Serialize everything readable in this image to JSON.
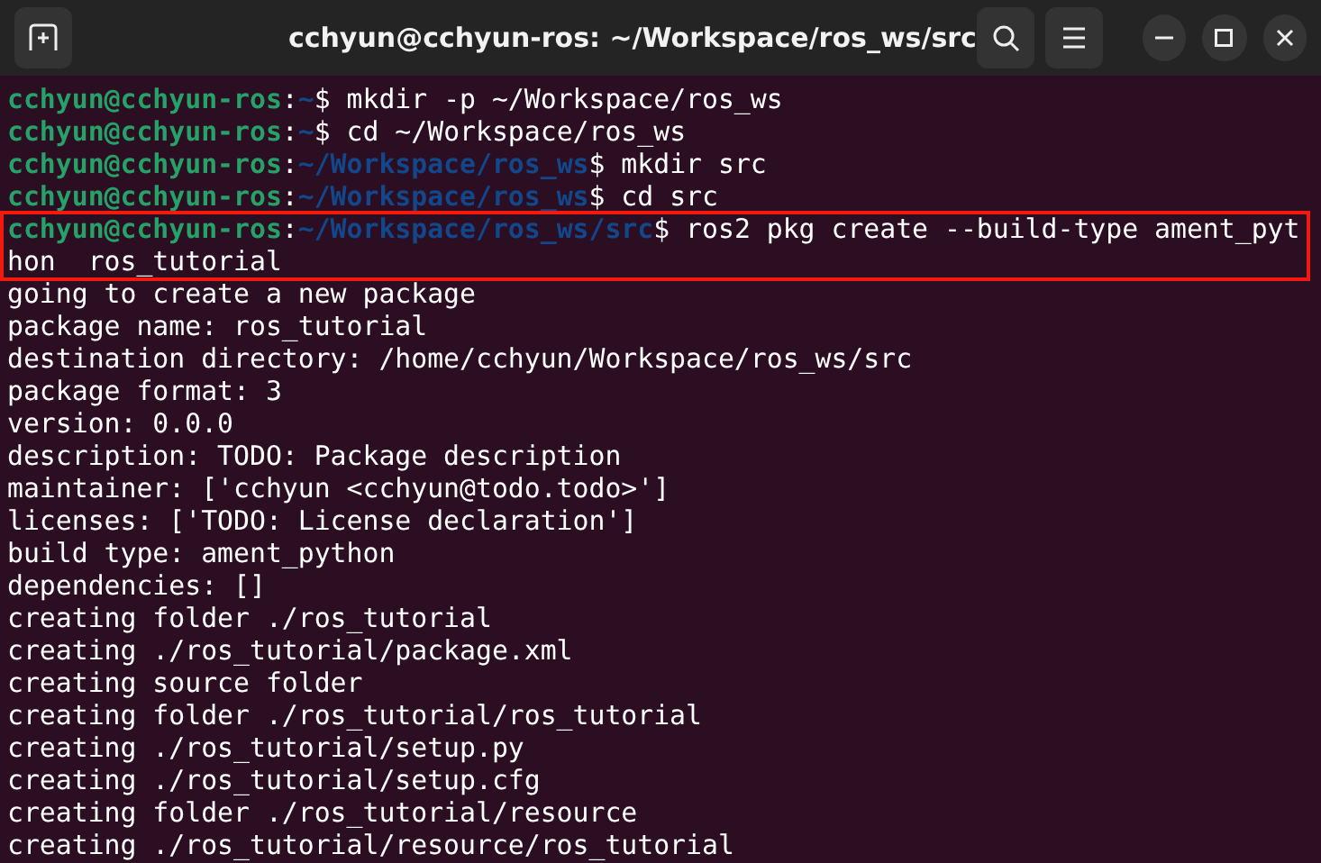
{
  "window": {
    "title": "cchyun@cchyun-ros: ~/Workspace/ros_ws/src"
  },
  "terminal": {
    "lines": [
      {
        "kind": "prompt",
        "user": "cchyun@cchyun-ros",
        "colon": ":",
        "path": "~",
        "dollar": "$",
        "command": " mkdir -p ~/Workspace/ros_ws"
      },
      {
        "kind": "prompt",
        "user": "cchyun@cchyun-ros",
        "colon": ":",
        "path": "~",
        "dollar": "$",
        "command": " cd ~/Workspace/ros_ws"
      },
      {
        "kind": "prompt",
        "user": "cchyun@cchyun-ros",
        "colon": ":",
        "path": "~/Workspace/ros_ws",
        "dollar": "$",
        "command": " mkdir src"
      },
      {
        "kind": "prompt",
        "user": "cchyun@cchyun-ros",
        "colon": ":",
        "path": "~/Workspace/ros_ws",
        "dollar": "$",
        "command": " cd src"
      },
      {
        "kind": "prompt",
        "user": "cchyun@cchyun-ros",
        "colon": ":",
        "path": "~/Workspace/ros_ws/src",
        "dollar": "$",
        "command": " ros2 pkg create --build-type ament_pyt"
      },
      {
        "kind": "output",
        "text": "hon  ros_tutorial"
      },
      {
        "kind": "output",
        "text": "going to create a new package"
      },
      {
        "kind": "output",
        "text": "package name: ros_tutorial"
      },
      {
        "kind": "output",
        "text": "destination directory: /home/cchyun/Workspace/ros_ws/src"
      },
      {
        "kind": "output",
        "text": "package format: 3"
      },
      {
        "kind": "output",
        "text": "version: 0.0.0"
      },
      {
        "kind": "output",
        "text": "description: TODO: Package description"
      },
      {
        "kind": "output",
        "text": "maintainer: ['cchyun <cchyun@todo.todo>']"
      },
      {
        "kind": "output",
        "text": "licenses: ['TODO: License declaration']"
      },
      {
        "kind": "output",
        "text": "build type: ament_python"
      },
      {
        "kind": "output",
        "text": "dependencies: []"
      },
      {
        "kind": "output",
        "text": "creating folder ./ros_tutorial"
      },
      {
        "kind": "output",
        "text": "creating ./ros_tutorial/package.xml"
      },
      {
        "kind": "output",
        "text": "creating source folder"
      },
      {
        "kind": "output",
        "text": "creating folder ./ros_tutorial/ros_tutorial"
      },
      {
        "kind": "output",
        "text": "creating ./ros_tutorial/setup.py"
      },
      {
        "kind": "output",
        "text": "creating ./ros_tutorial/setup.cfg"
      },
      {
        "kind": "output",
        "text": "creating folder ./ros_tutorial/resource"
      },
      {
        "kind": "output",
        "text": "creating ./ros_tutorial/resource/ros_tutorial"
      }
    ]
  }
}
